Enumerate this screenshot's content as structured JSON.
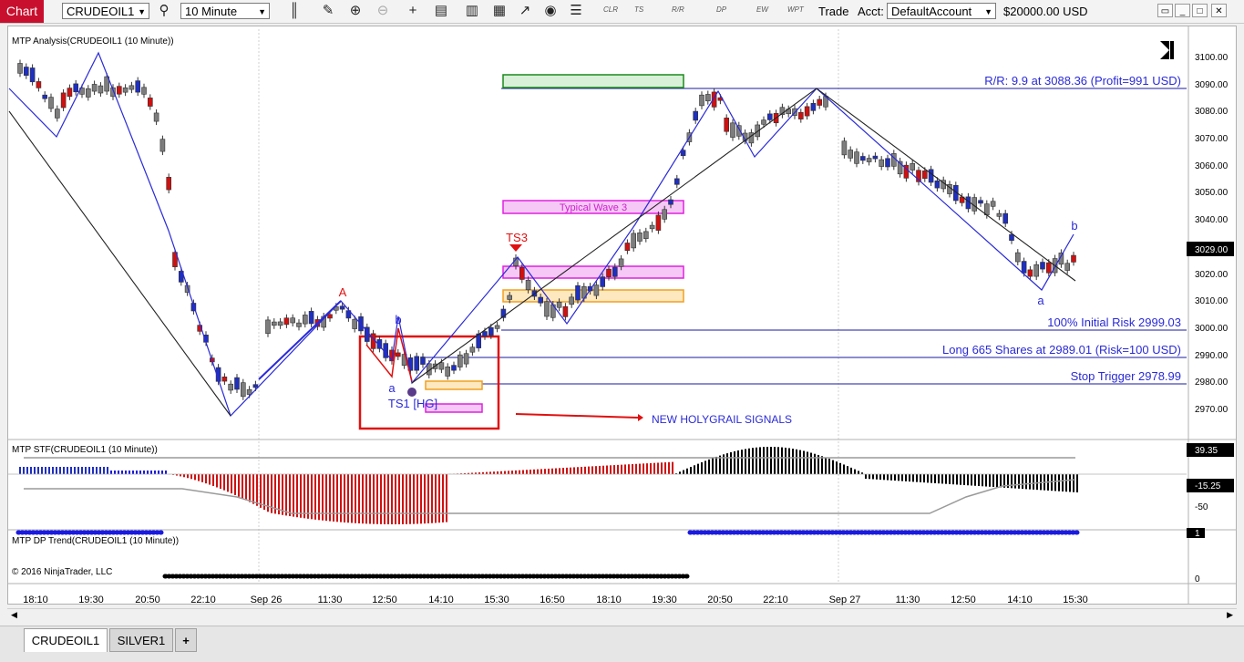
{
  "toolbar": {
    "chart_tab": "Chart",
    "instrument": "CRUDEOIL1",
    "interval": "10 Minute",
    "mini_buttons": [
      "CLR",
      "TS",
      "R/R",
      "DP",
      "EW",
      "WPT"
    ],
    "trade_label": "Trade",
    "acct_label": "Acct:",
    "account": "DefaultAccount",
    "balance": "$20000.00 USD"
  },
  "panels": {
    "price_title": "MTP Analysis(CRUDEOIL1 (10 Minute))",
    "stf_title": "MTP STF(CRUDEOIL1 (10 Minute))",
    "dp_title": "MTP DP Trend(CRUDEOIL1 (10 Minute))",
    "copyright": "© 2016 NinjaTrader, LLC"
  },
  "annotations": {
    "rr": "R/R: 9.9 at 3088.36 (Profit=991 USD)",
    "initial_risk": "100% Initial Risk 2999.03",
    "long": "Long 665 Shares at 2989.01 (Risk=100 USD)",
    "stop": "Stop Trigger 2978.99",
    "typical_wave": "Typical Wave 3",
    "ts3": "TS3",
    "ts1": "TS1 [HG]",
    "new_signals": "NEW HOLYGRAIL SIGNALS",
    "wave_A": "A",
    "wave_b1": "b",
    "wave_a1": "a",
    "wave_a2": "a",
    "wave_b2": "b"
  },
  "price_axis": {
    "ticks": [
      "3100.00",
      "3090.00",
      "3080.00",
      "3070.00",
      "3060.00",
      "3050.00",
      "3040.00",
      "3020.00",
      "3010.00",
      "3000.00",
      "2990.00",
      "2980.00",
      "2970.00"
    ],
    "current": "3029.00"
  },
  "stf_axis": {
    "value1": "39.35",
    "value2": "-15.25",
    "tick": "-50"
  },
  "dp_axis": {
    "tick1": "1",
    "tick0": "0"
  },
  "time_axis": [
    "18:10",
    "19:30",
    "20:50",
    "22:10",
    "Sep 26",
    "11:30",
    "12:50",
    "14:10",
    "15:30",
    "16:50",
    "18:10",
    "19:30",
    "20:50",
    "22:10",
    "Sep 27",
    "11:30",
    "12:50",
    "14:10",
    "15:30"
  ],
  "tabs": [
    "CRUDEOIL1",
    "SILVER1",
    "+"
  ],
  "colors": {
    "up": "#1f2fbf",
    "down": "#d01010",
    "neutral": "#7d7d7d",
    "zigzag": "#2a2ad8",
    "magenta": "#e020e0",
    "orange": "#f0a020",
    "green": "#1a8a1a"
  }
}
